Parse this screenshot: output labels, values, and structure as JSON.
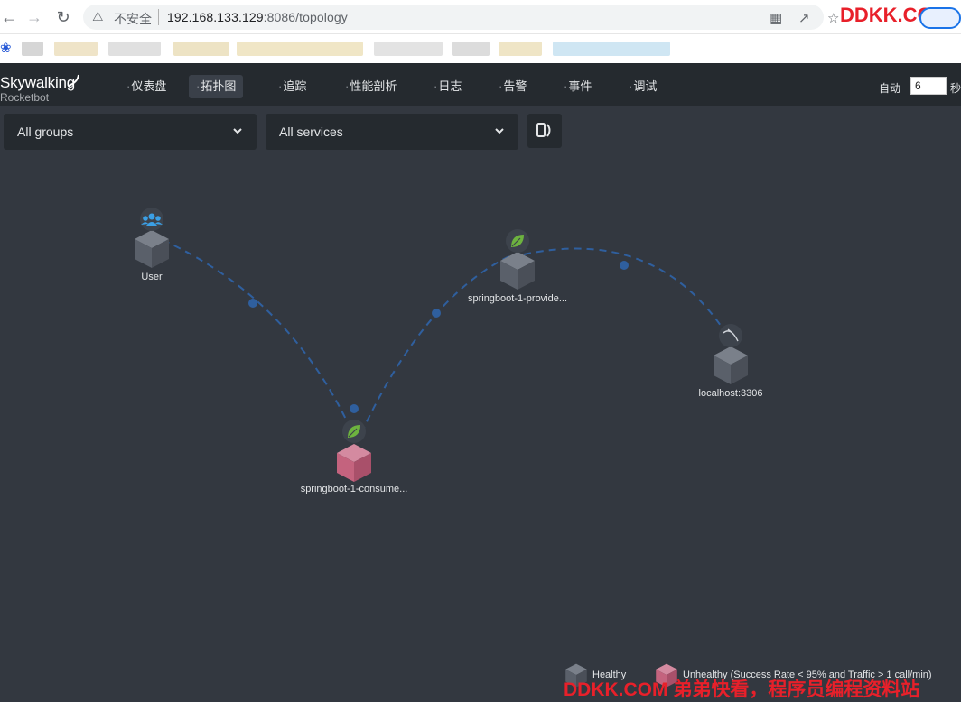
{
  "browser": {
    "insecure_label": "不安全",
    "url_host": "192.168.133.129",
    "url_rest": ":8086/topology",
    "watermark_top": "DDKK.COM"
  },
  "app": {
    "logo": "Skywalking",
    "logo_sub": "Rocketbot",
    "nav": [
      {
        "label": "仪表盘"
      },
      {
        "label": "拓扑图",
        "active": true
      },
      {
        "label": "追踪"
      },
      {
        "label": "性能剖析"
      },
      {
        "label": "日志"
      },
      {
        "label": "告警"
      },
      {
        "label": "事件"
      },
      {
        "label": "调试"
      }
    ],
    "auto_label": "自动",
    "auto_value": "6",
    "seconds_label": "秒"
  },
  "toolbar": {
    "group_select": "All groups",
    "service_select": "All services"
  },
  "topology": {
    "nodes": [
      {
        "name": "User",
        "icon": "users-icon",
        "health": "healthy"
      },
      {
        "name": "springboot-1-provide...",
        "icon": "spring-leaf-icon",
        "health": "healthy"
      },
      {
        "name": "localhost:3306",
        "icon": "mysql-icon",
        "health": "healthy"
      },
      {
        "name": "springboot-1-consume...",
        "icon": "spring-leaf-icon",
        "health": "unhealthy"
      }
    ],
    "links": [
      {
        "from": "User",
        "to": "springboot-1-consume..."
      },
      {
        "from": "springboot-1-consume...",
        "to": "springboot-1-provide..."
      },
      {
        "from": "springboot-1-provide...",
        "to": "localhost:3306"
      }
    ]
  },
  "legend": {
    "healthy": "Healthy",
    "unhealthy": "Unhealthy (Success Rate < 95% and Traffic > 1 call/min)"
  },
  "colors": {
    "background": "#333840",
    "header": "#252a2f",
    "healthy_node": "#5f6570",
    "unhealthy_node": "#c4637e",
    "link": "#2f5f9e",
    "watermark": "#e8202a"
  },
  "watermark_bottom": "DDKK.COM 弟弟快看，程序员编程资料站"
}
